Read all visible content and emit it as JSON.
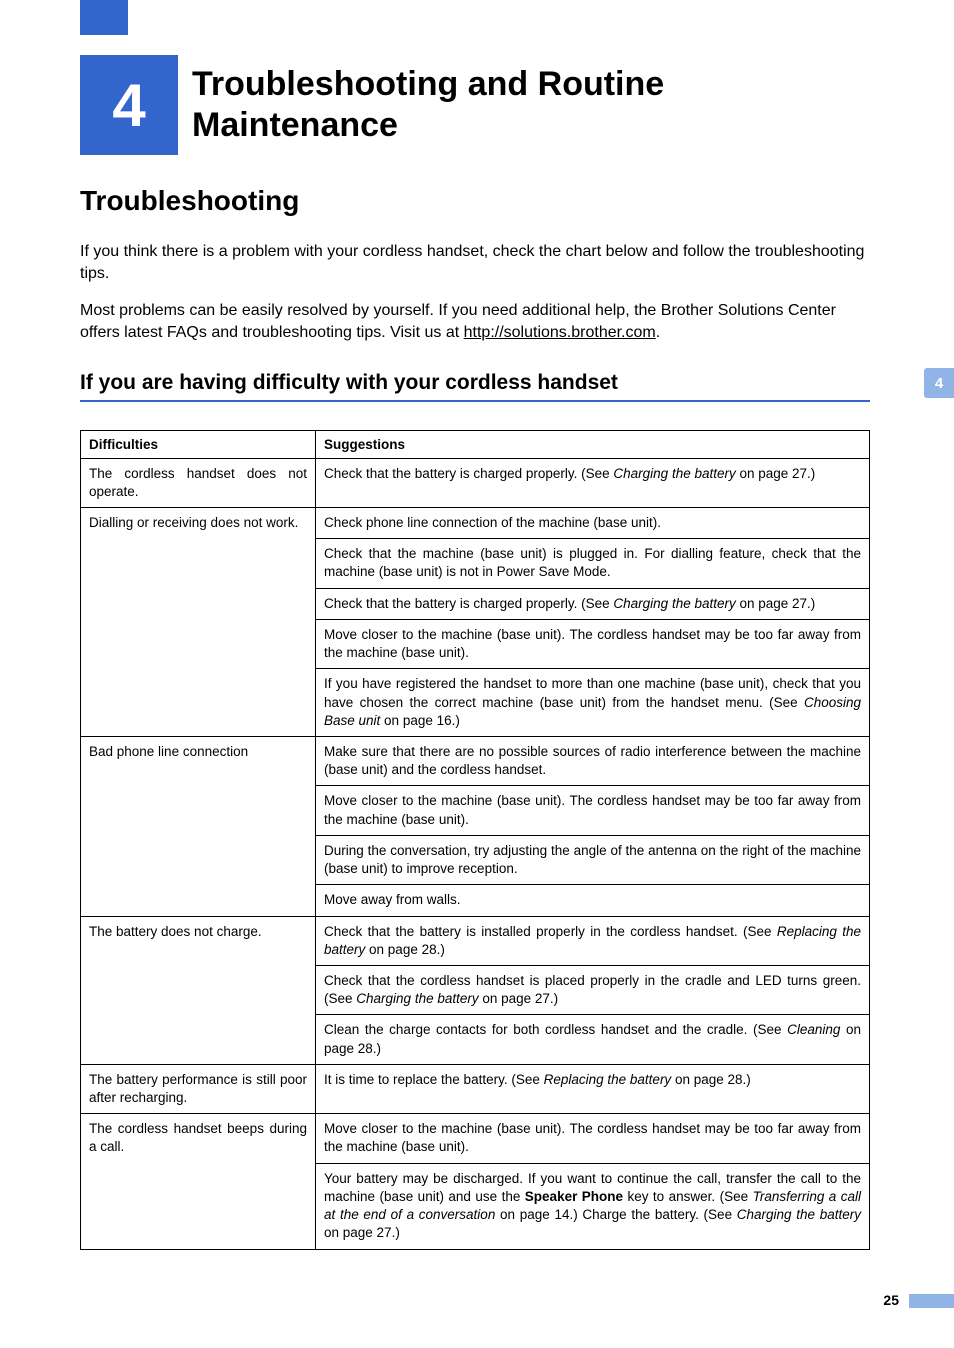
{
  "chapter": {
    "number": "4",
    "title_line1": "Troubleshooting and Routine",
    "title_line2": "Maintenance"
  },
  "side_tab": "4",
  "section_title": "Troubleshooting",
  "intro1": "If you think there is a problem with your cordless handset, check the chart below and follow the troubleshooting tips.",
  "intro2_part1": "Most problems can be easily resolved by yourself. If you need additional help, the Brother Solutions Center offers latest FAQs and troubleshooting tips. Visit us at ",
  "intro2_link": "http://solutions.brother.com",
  "intro2_part2": ".",
  "subsection_title": "If you are having difficulty with your cordless handset",
  "table": {
    "header_col1": "Difficulties",
    "header_col2": "Suggestions",
    "rows": [
      {
        "difficulty": "The cordless handset does not operate.",
        "suggestions": [
          {
            "t1": "Check that the battery is charged properly. (See ",
            "i": "Charging the battery",
            "t2": " on page 27.)"
          }
        ]
      },
      {
        "difficulty": "Dialling or receiving does not work.",
        "suggestions": [
          {
            "t1": "Check phone line connection of the machine (base unit)."
          },
          {
            "t1": "Check that the machine (base unit) is plugged in. For dialling feature, check that the machine (base unit) is not in Power Save Mode."
          },
          {
            "t1": "Check that the battery is charged properly. (See ",
            "i": "Charging the battery",
            "t2": " on page 27.)"
          },
          {
            "t1": "Move closer to the machine (base unit). The cordless handset may be too far away from the machine (base unit)."
          },
          {
            "t1": "If you have registered the handset to more than one machine (base unit), check that you have chosen the correct machine (base unit) from the handset menu. (See ",
            "i": "Choosing Base unit",
            "t2": " on page 16.)"
          }
        ]
      },
      {
        "difficulty": "Bad phone line connection",
        "suggestions": [
          {
            "t1": "Make sure that there are no possible sources of radio interference between the machine (base unit) and the cordless handset."
          },
          {
            "t1": "Move closer to the machine (base unit). The cordless handset may be too far away from the machine (base unit)."
          },
          {
            "t1": "During the conversation, try adjusting the angle of the antenna on the right of the machine (base unit) to improve reception."
          },
          {
            "t1": "Move away from walls."
          }
        ]
      },
      {
        "difficulty": "The battery does not charge.",
        "suggestions": [
          {
            "t1": "Check that the battery is installed properly in the cordless handset. (See ",
            "i": "Replacing the battery",
            "t2": " on page 28.)"
          },
          {
            "t1": "Check that the cordless handset is placed properly in the cradle and LED turns green. (See ",
            "i": "Charging the battery",
            "t2": " on page 27.)"
          },
          {
            "t1": "Clean the charge contacts for both cordless handset and the cradle. (See ",
            "i": "Cleaning",
            "t2": " on page 28.)"
          }
        ]
      },
      {
        "difficulty": "The battery performance is still poor after recharging.",
        "suggestions": [
          {
            "t1": "It is time to replace the battery. (See ",
            "i": "Replacing the battery",
            "t2": " on page 28.)"
          }
        ]
      },
      {
        "difficulty": "The cordless handset beeps during a call.",
        "suggestions": [
          {
            "t1": "Move closer to the machine (base unit). The cordless handset may be too far away from the machine (base unit)."
          },
          {
            "t1": "Your battery may be discharged. If you want to continue the call, transfer the call to the machine (base unit) and use the ",
            "b": "Speaker Phone",
            "t2": " key to answer. (See ",
            "i": "Transferring a call at the end of a conversation",
            "t3": " on page 14.) Charge the battery. (See ",
            "i2": "Charging the battery",
            "t4": " on page 27.)"
          }
        ]
      }
    ]
  },
  "page_number": "25"
}
